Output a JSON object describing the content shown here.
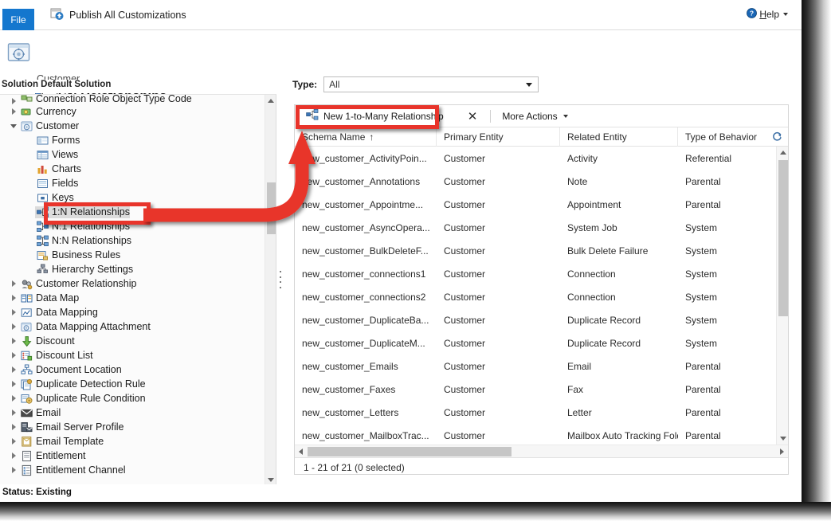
{
  "ribbon": {
    "file_tab": "File",
    "publish_label": "Publish All Customizations",
    "publish_icon": "publish-icon",
    "help_label": "Help",
    "help_icon": "help-icon"
  },
  "page": {
    "breadcrumb": "Customer",
    "title": "1:N Relationships",
    "title_icon": "entity-gear-icon",
    "relationship_icon": "relationship-1n-icon",
    "solution_bar": "Solution Default Solution"
  },
  "tree": {
    "items": [
      {
        "label": "Connection Role Object Type Code",
        "indent": 1,
        "state": "collapsed",
        "icon": "mapping-icon",
        "clipped": true
      },
      {
        "label": "Currency",
        "indent": 1,
        "state": "collapsed",
        "icon": "currency-icon"
      },
      {
        "label": "Customer",
        "indent": 1,
        "state": "expanded",
        "icon": "entity-gear-icon"
      },
      {
        "label": "Forms",
        "indent": 2,
        "state": "leaf",
        "icon": "forms-icon"
      },
      {
        "label": "Views",
        "indent": 2,
        "state": "leaf",
        "icon": "views-icon"
      },
      {
        "label": "Charts",
        "indent": 2,
        "state": "leaf",
        "icon": "charts-icon"
      },
      {
        "label": "Fields",
        "indent": 2,
        "state": "leaf",
        "icon": "fields-icon"
      },
      {
        "label": "Keys",
        "indent": 2,
        "state": "leaf",
        "icon": "keys-icon"
      },
      {
        "label": "1:N Relationships",
        "indent": 2,
        "state": "leaf",
        "icon": "relationship-1n-icon",
        "selected": true
      },
      {
        "label": "N:1 Relationships",
        "indent": 2,
        "state": "leaf",
        "icon": "relationship-n1-icon"
      },
      {
        "label": "N:N Relationships",
        "indent": 2,
        "state": "leaf",
        "icon": "relationship-nn-icon"
      },
      {
        "label": "Business Rules",
        "indent": 2,
        "state": "leaf",
        "icon": "business-rules-icon"
      },
      {
        "label": "Hierarchy Settings",
        "indent": 2,
        "state": "leaf",
        "icon": "hierarchy-icon"
      },
      {
        "label": "Customer Relationship",
        "indent": 1,
        "state": "collapsed",
        "icon": "customer-relationship-icon"
      },
      {
        "label": "Data Map",
        "indent": 1,
        "state": "collapsed",
        "icon": "data-map-icon"
      },
      {
        "label": "Data Mapping",
        "indent": 1,
        "state": "collapsed",
        "icon": "data-mapping-icon"
      },
      {
        "label": "Data Mapping Attachment",
        "indent": 1,
        "state": "collapsed",
        "icon": "data-mapping-attachment-icon"
      },
      {
        "label": "Discount",
        "indent": 1,
        "state": "collapsed",
        "icon": "discount-icon"
      },
      {
        "label": "Discount List",
        "indent": 1,
        "state": "collapsed",
        "icon": "discount-list-icon"
      },
      {
        "label": "Document Location",
        "indent": 1,
        "state": "collapsed",
        "icon": "document-location-icon"
      },
      {
        "label": "Duplicate Detection Rule",
        "indent": 1,
        "state": "collapsed",
        "icon": "duplicate-detection-icon"
      },
      {
        "label": "Duplicate Rule Condition",
        "indent": 1,
        "state": "collapsed",
        "icon": "duplicate-rule-icon"
      },
      {
        "label": "Email",
        "indent": 1,
        "state": "collapsed",
        "icon": "email-icon"
      },
      {
        "label": "Email Server Profile",
        "indent": 1,
        "state": "collapsed",
        "icon": "email-server-icon"
      },
      {
        "label": "Email Template",
        "indent": 1,
        "state": "collapsed",
        "icon": "email-template-icon"
      },
      {
        "label": "Entitlement",
        "indent": 1,
        "state": "collapsed",
        "icon": "entitlement-icon"
      },
      {
        "label": "Entitlement Channel",
        "indent": 1,
        "state": "collapsed",
        "icon": "entitlement-channel-icon"
      }
    ]
  },
  "filter": {
    "type_label": "Type:",
    "type_value": "All"
  },
  "commandbar": {
    "new_label": "New 1-to-Many Relationship",
    "new_icon": "relationship-1n-icon",
    "delete_icon": "close-x-icon",
    "more_actions_label": "More Actions"
  },
  "grid": {
    "columns": [
      "Schema Name",
      "Primary Entity",
      "Related Entity",
      "Type of Behavior"
    ],
    "sort_column": "Schema Name",
    "sort_direction": "ascending",
    "refresh_icon": "refresh-icon",
    "rows": [
      {
        "schema": "new_customer_ActivityPoin...",
        "primary": "Customer",
        "related": "Activity",
        "behavior": "Referential"
      },
      {
        "schema": "new_customer_Annotations",
        "primary": "Customer",
        "related": "Note",
        "behavior": "Parental"
      },
      {
        "schema": "new_customer_Appointme...",
        "primary": "Customer",
        "related": "Appointment",
        "behavior": "Parental"
      },
      {
        "schema": "new_customer_AsyncOpera...",
        "primary": "Customer",
        "related": "System Job",
        "behavior": "System"
      },
      {
        "schema": "new_customer_BulkDeleteF...",
        "primary": "Customer",
        "related": "Bulk Delete Failure",
        "behavior": "System"
      },
      {
        "schema": "new_customer_connections1",
        "primary": "Customer",
        "related": "Connection",
        "behavior": "System"
      },
      {
        "schema": "new_customer_connections2",
        "primary": "Customer",
        "related": "Connection",
        "behavior": "System"
      },
      {
        "schema": "new_customer_DuplicateBa...",
        "primary": "Customer",
        "related": "Duplicate Record",
        "behavior": "System"
      },
      {
        "schema": "new_customer_DuplicateM...",
        "primary": "Customer",
        "related": "Duplicate Record",
        "behavior": "System"
      },
      {
        "schema": "new_customer_Emails",
        "primary": "Customer",
        "related": "Email",
        "behavior": "Parental"
      },
      {
        "schema": "new_customer_Faxes",
        "primary": "Customer",
        "related": "Fax",
        "behavior": "Parental"
      },
      {
        "schema": "new_customer_Letters",
        "primary": "Customer",
        "related": "Letter",
        "behavior": "Parental"
      },
      {
        "schema": "new_customer_MailboxTrac...",
        "primary": "Customer",
        "related": "Mailbox Auto Tracking Fold...",
        "behavior": "Parental"
      }
    ],
    "footer": "1 - 21 of 21 (0 selected)"
  },
  "statusbar": {
    "text": "Status: Existing"
  },
  "colors": {
    "annotation_red": "#E8342B",
    "file_tab_blue": "#1477CE",
    "selection_gray": "#DCDCDC"
  }
}
